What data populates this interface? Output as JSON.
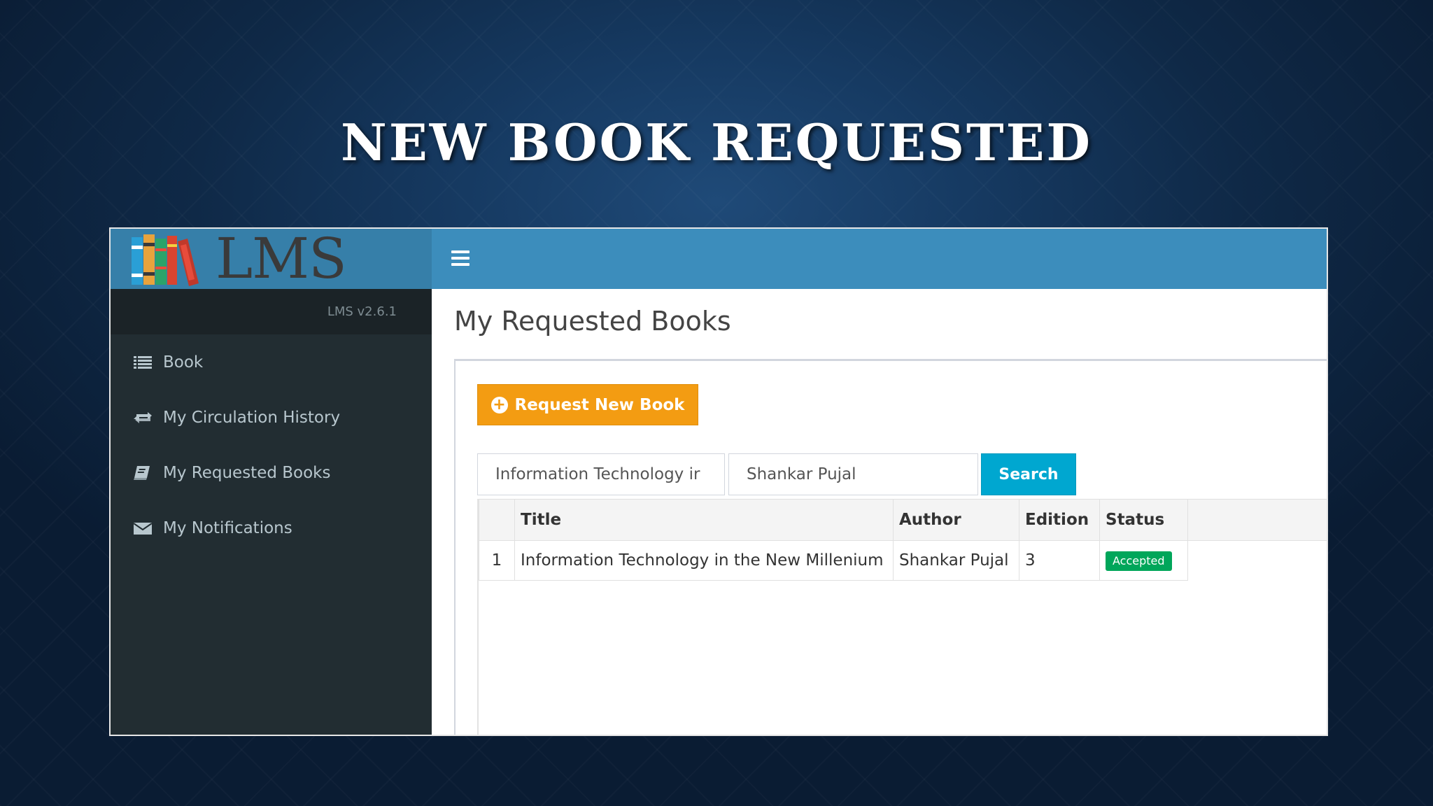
{
  "slide": {
    "title": "NEW BOOK REQUESTED"
  },
  "app": {
    "logo_text": "LMS",
    "version": "LMS v2.6.1"
  },
  "sidebar": {
    "items": [
      {
        "label": "Book",
        "icon": "list-icon"
      },
      {
        "label": "My Circulation History",
        "icon": "retweet-icon"
      },
      {
        "label": "My Requested Books",
        "icon": "book-icon"
      },
      {
        "label": "My Notifications",
        "icon": "envelope-icon"
      }
    ]
  },
  "main": {
    "title": "My Requested Books",
    "request_button": "Request New Book",
    "search": {
      "title_value": "Information Technology ir",
      "author_value": "Shankar Pujal",
      "button": "Search"
    },
    "table": {
      "headers": [
        "",
        "Title",
        "Author",
        "Edition",
        "Status"
      ],
      "rows": [
        {
          "no": "1",
          "title": "Information Technology in the New Millenium",
          "author": "Shankar Pujal",
          "edition": "3",
          "status": "Accepted"
        }
      ]
    }
  },
  "colors": {
    "header": "#3c8dbc",
    "sidebar": "#222d32",
    "request_button": "#f39c12",
    "search_button": "#00a7d0",
    "status_accepted": "#00a65a"
  }
}
